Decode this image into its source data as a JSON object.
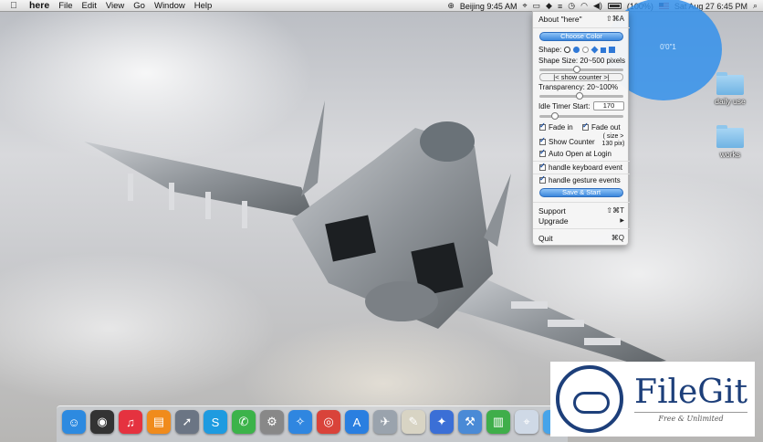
{
  "menubar": {
    "app_name": "here",
    "menus": [
      "File",
      "Edit",
      "View",
      "Go",
      "Window",
      "Help"
    ],
    "clock": "Beijing 9:45 AM",
    "battery": "(100%)",
    "datetime": "Sat Aug 27  6:45 PM"
  },
  "overlay": {
    "coordinates": "0'0\"1"
  },
  "desktop": {
    "folders": [
      {
        "label": "daily use"
      },
      {
        "label": "works"
      }
    ]
  },
  "menu": {
    "about": {
      "label": "About \"here\"",
      "shortcut": "⇧⌘A"
    },
    "choose_color": "Choose Color",
    "shape_label": "Shape:",
    "shape_size_label": "Shape Size: 20~500 pixels",
    "shape_size_fraction": 0.44,
    "show_counter_label": "|< show counter >|",
    "transparency_label": "Transparency: 20~100%",
    "transparency_fraction": 0.48,
    "idle_label": "Idle Timer Start:",
    "idle_value": "170",
    "idle_fraction": 0.15,
    "fade_in": "Fade in",
    "fade_out": "Fade out",
    "show_counter": "Show Counter",
    "size_note": "( size > 130 pix)",
    "auto_open": "Auto Open at Login",
    "keyboard": "handle keyboard event",
    "gesture": "handle gesture events",
    "save_start": "Save & Start",
    "support": {
      "label": "Support",
      "shortcut": "⇧⌘T"
    },
    "upgrade": {
      "label": "Upgrade",
      "arrow": "▶"
    },
    "quit": {
      "label": "Quit",
      "shortcut": "⌘Q"
    }
  },
  "dock": {
    "apps": [
      {
        "icon": "finder-icon",
        "glyph": "☺",
        "color": "#2d8ae0"
      },
      {
        "icon": "dashboard-icon",
        "glyph": "◉",
        "color": "#333333"
      },
      {
        "icon": "music-icon",
        "glyph": "♫",
        "color": "#e5323f"
      },
      {
        "icon": "books-icon",
        "glyph": "▤",
        "color": "#f08b1c"
      },
      {
        "icon": "launchpad-icon",
        "glyph": "➚",
        "color": "#6b7584"
      },
      {
        "icon": "skype-icon",
        "glyph": "S",
        "color": "#1e9be0"
      },
      {
        "icon": "facetime-icon",
        "glyph": "✆",
        "color": "#3cb34a"
      },
      {
        "icon": "system-preferences-icon",
        "glyph": "⚙",
        "color": "#888888"
      },
      {
        "icon": "safari-icon",
        "glyph": "✧",
        "color": "#2f86e0"
      },
      {
        "icon": "chrome-icon",
        "glyph": "◎",
        "color": "#d9433a"
      },
      {
        "icon": "app-store-icon",
        "glyph": "A",
        "color": "#2a7fe0"
      },
      {
        "icon": "airplane-icon",
        "glyph": "✈",
        "color": "#9aa3ad"
      },
      {
        "icon": "notes-icon",
        "glyph": "✎",
        "color": "#d8d4c4"
      },
      {
        "icon": "design-icon",
        "glyph": "✦",
        "color": "#3b6fd6"
      },
      {
        "icon": "xcode-icon",
        "glyph": "⚒",
        "color": "#4a8ad6"
      },
      {
        "icon": "numbers-icon",
        "glyph": "▥",
        "color": "#3fae4a"
      },
      {
        "icon": "here-app-icon",
        "glyph": "⌖",
        "color": "#cfd9e6"
      },
      {
        "icon": "messages-icon",
        "glyph": "✉",
        "color": "#46a4ea"
      }
    ]
  },
  "watermark": {
    "title": "FileGit",
    "subtitle": "Free & Unlimited"
  },
  "colors": {
    "accent": "#3a86dc",
    "overlay": "#3491eb",
    "brand": "#1d3f7a"
  }
}
